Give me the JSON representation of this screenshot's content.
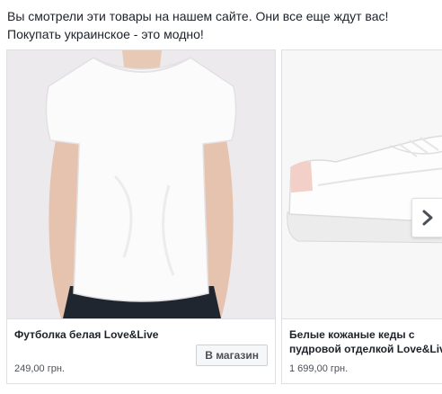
{
  "ad": {
    "line1": "Вы смотрели эти товары на нашем сайте. Они все еще ждут вас!",
    "line2": "Покупать украинское - это модно!"
  },
  "cards": [
    {
      "title": "Футболка белая Love&Live",
      "price": "249,00 грн.",
      "button_label": "В магазин",
      "image_icon": "white-tshirt-photo"
    },
    {
      "title": "Белые кожаные кеды с пудровой отделкой Love&Live",
      "price": "1 699,00 грн.",
      "image_icon": "white-sneaker-photo"
    }
  ],
  "carousel": {
    "next_icon": "chevron-right-icon"
  },
  "colors": {
    "border": "#dddfe2",
    "text": "#1d2129",
    "muted": "#4b4f56",
    "photo_bg": "#eceaed",
    "accent_pink": "#f2cfc7"
  }
}
